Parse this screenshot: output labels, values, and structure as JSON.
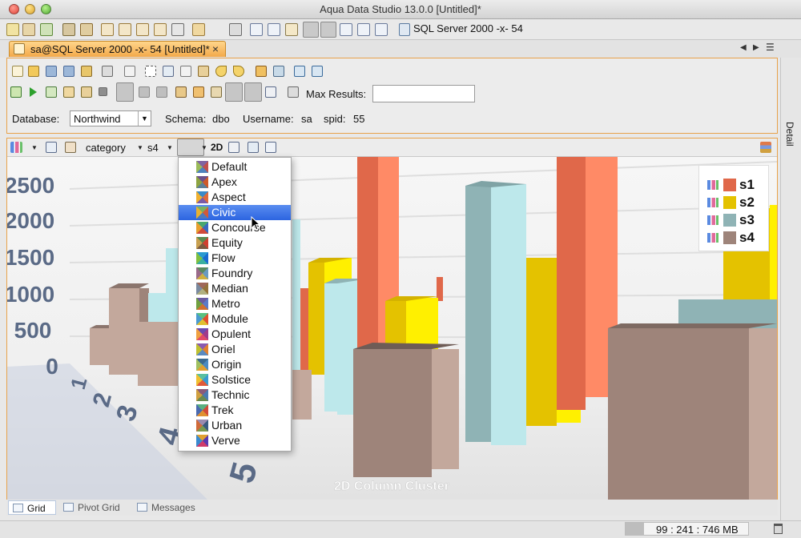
{
  "window": {
    "title": "Aqua Data Studio 13.0.0 [Untitled]*"
  },
  "main_toolbar": {
    "server_label": "SQL Server 2000 -x- 54"
  },
  "query_tab": {
    "label": "sa@SQL Server 2000 -x- 54 [Untitled]*",
    "close": "×"
  },
  "editor": {
    "max_results_label": "Max Results:",
    "max_results_value": "",
    "database_label": "Database:",
    "database_value": "Northwind",
    "schema_label": "Schema:",
    "schema_value": "dbo",
    "username_label": "Username:",
    "username_value": "sa",
    "spid_label": "spid:",
    "spid_value": "55"
  },
  "detail_panel": {
    "label": "Detail"
  },
  "chart_toolbar": {
    "category": "category",
    "series": "s4",
    "mode_2d": "2D"
  },
  "theme_menu": {
    "selected": "Civic",
    "items": [
      "Default",
      "Apex",
      "Aspect",
      "Civic",
      "Concourse",
      "Equity",
      "Flow",
      "Foundry",
      "Median",
      "Metro",
      "Module",
      "Opulent",
      "Oriel",
      "Origin",
      "Solstice",
      "Technic",
      "Trek",
      "Urban",
      "Verve"
    ]
  },
  "chart_data": {
    "type": "bar",
    "title": "2D Column Cluster",
    "categories": [
      "1",
      "2",
      "3",
      "4",
      "5"
    ],
    "y_ticks": [
      "2500",
      "2000",
      "1500",
      "1000",
      "500",
      "0"
    ],
    "series": [
      {
        "name": "s1",
        "color": "#e0684a"
      },
      {
        "name": "s2",
        "color": "#e4c200"
      },
      {
        "name": "s3",
        "color": "#8fb3b5"
      },
      {
        "name": "s4",
        "color": "#9e847a"
      }
    ]
  },
  "bottom_tabs": [
    "Grid",
    "Pivot Grid",
    "Messages"
  ],
  "status_bar": {
    "memory_text": "99 : 241 : 746 MB",
    "memory_used_fraction": 0.15
  }
}
